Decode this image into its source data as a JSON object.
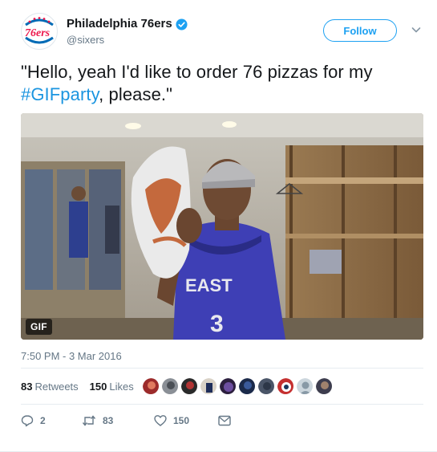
{
  "account": {
    "display_name": "Philadelphia 76ers",
    "handle": "@sixers",
    "avatar_text": "76ers",
    "verified": true
  },
  "follow_label": "Follow",
  "tweet": {
    "text_before": "\"Hello, yeah I'd like to order 76 pizzas for my ",
    "hashtag": "#GIFparty",
    "text_after": ", please.\""
  },
  "media": {
    "badge": "GIF",
    "jersey_text": "EAST",
    "jersey_number": "3"
  },
  "timestamp": "7:50 PM - 3 Mar 2016",
  "stats": {
    "retweets_count": "83",
    "retweets_label": "Retweets",
    "likes_count": "150",
    "likes_label": "Likes"
  },
  "actions": {
    "reply_count": "2",
    "retweet_count": "83",
    "like_count": "150"
  },
  "colors": {
    "accent": "#1da1f2",
    "hashtag": "#1b95e0",
    "muted": "#657786",
    "text": "#14171a"
  }
}
